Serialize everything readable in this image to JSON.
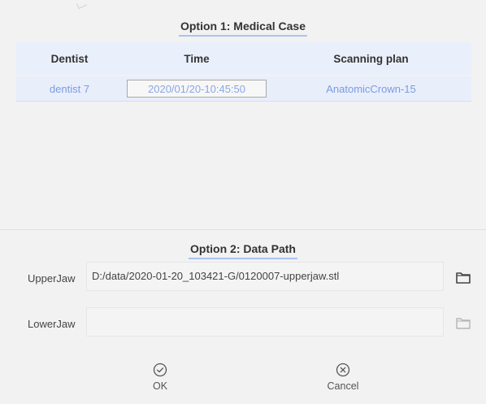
{
  "option1": {
    "title": "Option 1:  Medical Case",
    "headers": [
      "Dentist",
      "Time",
      "Scanning plan"
    ],
    "rows": [
      {
        "dentist": "dentist 7",
        "time": "2020/01/20-10:45:50",
        "plan": "AnatomicCrown-15"
      }
    ]
  },
  "option2": {
    "title": "Option 2:  Data Path",
    "upper_label": "UpperJaw",
    "upper_value": "D:/data/2020-01-20_103421-G/0120007-upperjaw.stl",
    "lower_label": "LowerJaw",
    "lower_value": ""
  },
  "actions": {
    "ok_label": "OK",
    "cancel_label": "Cancel"
  },
  "colors": {
    "accent": "#a9c4f2",
    "row_text": "#7a9be2",
    "header_bg": "#eaf0fb"
  },
  "icons": {
    "upper_folder": "folder-icon",
    "lower_folder": "folder-icon",
    "ok": "check-circle-icon",
    "cancel": "x-circle-icon"
  }
}
